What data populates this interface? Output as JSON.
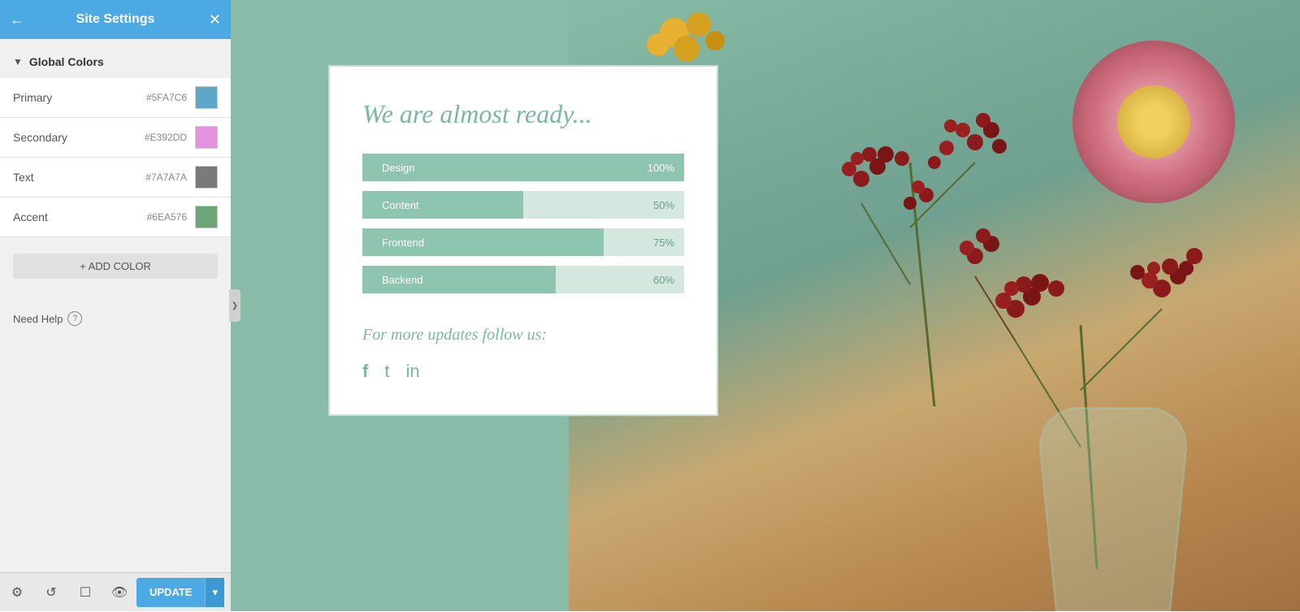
{
  "sidebar": {
    "title": "Site Settings",
    "back_icon": "←",
    "close_icon": "✕",
    "section": {
      "label": "Global Colors",
      "chevron": "▼"
    },
    "colors": [
      {
        "label": "Primary",
        "hex": "#5FA7C6",
        "swatch": "#5FA7C6"
      },
      {
        "label": "Secondary",
        "hex": "#E392DD",
        "swatch": "#E392DD"
      },
      {
        "label": "Text",
        "hex": "#7A7A7A",
        "swatch": "#7A7A7A"
      },
      {
        "label": "Accent",
        "hex": "#6EA576",
        "swatch": "#6EA576"
      }
    ],
    "add_color_label": "+ ADD COLOR",
    "need_help_label": "Need Help",
    "help_icon": "?",
    "collapse_icon": "❯"
  },
  "toolbar": {
    "settings_icon": "⚙",
    "history_icon": "↺",
    "preview_icon": "☐",
    "eye_icon": "👁",
    "update_label": "UPDATE",
    "update_arrow": "▾"
  },
  "preview": {
    "title": "We are almost ready...",
    "bars": [
      {
        "label": "Design",
        "percent": 100,
        "display": "100%"
      },
      {
        "label": "Content",
        "percent": 50,
        "display": "50%"
      },
      {
        "label": "Frontend",
        "percent": 75,
        "display": "75%"
      },
      {
        "label": "Backend",
        "percent": 60,
        "display": "60%"
      }
    ],
    "follow_text": "For more updates follow us:",
    "social_icons": [
      "f",
      "t",
      "in"
    ]
  }
}
